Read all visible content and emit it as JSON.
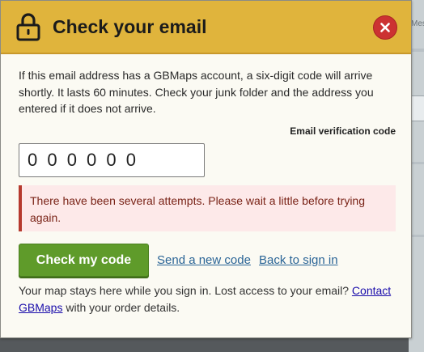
{
  "dialog": {
    "title": "Check your email",
    "close_label": "Close",
    "intro": "If this email address has a GBMaps account, a six-digit code will arrive shortly. It lasts 60 minutes. Check your junk folder and the address you entered if it does not arrive.",
    "code_field": {
      "label": "Email verification code",
      "value": "000000"
    },
    "alert": "There have been several attempts. Please wait a little before trying again.",
    "primary_button": "Check my code",
    "send_new_code_link": "Send a new code",
    "back_to_sign_in_link": "Back to sign in",
    "footer": {
      "text": "Your map stays here while you sign in. Lost access to your email?",
      "contact_link": "Contact GBMaps",
      "text_after": "with your order details."
    }
  },
  "background": {
    "map_label_fragment": "Mes"
  },
  "colors": {
    "header": "#e0b43c",
    "close": "#cc3232",
    "primary": "#5f9b2a",
    "alert_border": "#b63a2e",
    "alert_bg": "#fde9e9",
    "link": "#2a6496"
  },
  "icons": {
    "header": "lock-icon",
    "close": "close-icon"
  }
}
